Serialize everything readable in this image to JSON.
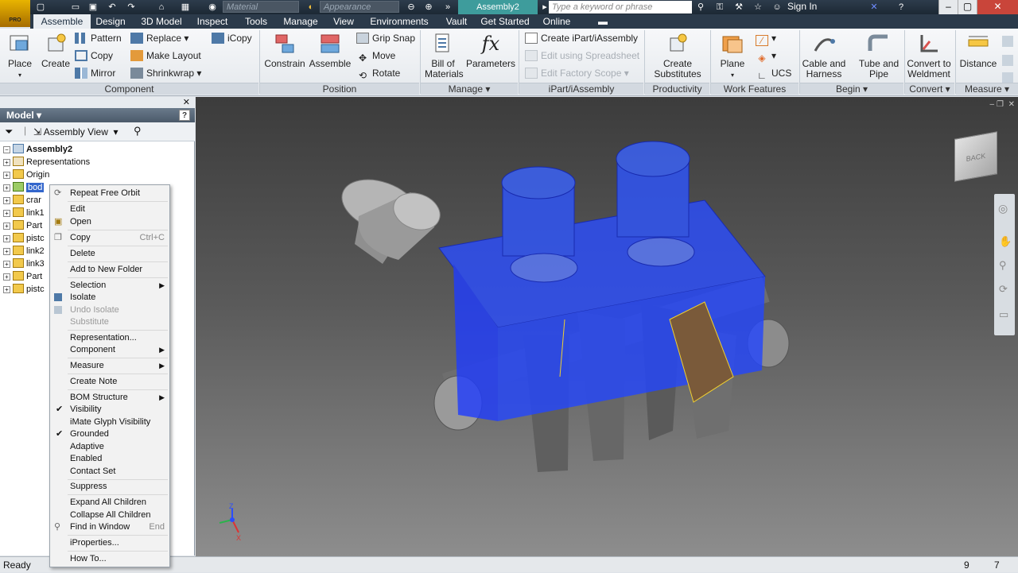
{
  "app": {
    "logo_text": "PRO"
  },
  "quickaccess": {
    "material_placeholder": "Material",
    "appearance_placeholder": "Appearance"
  },
  "title": {
    "document": "Assembly2",
    "search_placeholder": "Type a keyword or phrase",
    "sign_in": "Sign In"
  },
  "menu": [
    "Assemble",
    "Design",
    "3D Model",
    "Inspect",
    "Tools",
    "Manage",
    "View",
    "Environments",
    "Vault",
    "Get Started",
    "Online"
  ],
  "ribbon": {
    "groups": [
      "Component",
      "Position",
      "Manage",
      "iPart/iAssembly",
      "Productivity",
      "Work Features",
      "Begin",
      "Convert",
      "Measure"
    ],
    "component": {
      "place": "Place",
      "create": "Create",
      "pattern": "Pattern",
      "copy": "Copy",
      "mirror": "Mirror",
      "replace": "Replace",
      "make_layout": "Make Layout",
      "shrinkwrap": "Shrinkwrap",
      "icopy": "iCopy"
    },
    "position": {
      "constrain": "Constrain",
      "assemble": "Assemble",
      "grip_snap": "Grip Snap",
      "move": "Move",
      "rotate": "Rotate"
    },
    "manage": {
      "bom_line1": "Bill of",
      "bom_line2": "Materials",
      "parameters": "Parameters"
    },
    "ipart": {
      "create": "Create iPart/iAssembly",
      "edit_spreadsheet": "Edit using Spreadsheet",
      "edit_factory": "Edit Factory Scope"
    },
    "productivity": {
      "line1": "Create",
      "line2": "Substitutes"
    },
    "work_features": {
      "plane": "Plane",
      "ucs": "UCS"
    },
    "begin": {
      "cable_line1": "Cable and",
      "cable_line2": "Harness",
      "tube_line1": "Tube and",
      "tube_line2": "Pipe"
    },
    "convert": {
      "line1": "Convert to",
      "line2": "Weldment"
    },
    "measure": {
      "distance": "Distance"
    }
  },
  "panel": {
    "title": "Model",
    "view": "Assembly View"
  },
  "tree": [
    {
      "label": "Assembly2",
      "bold": true
    },
    {
      "label": "Representations"
    },
    {
      "label": "Origin"
    },
    {
      "label": "bod",
      "selected": true
    },
    {
      "label": "crar"
    },
    {
      "label": "link1"
    },
    {
      "label": "Part"
    },
    {
      "label": "pistc"
    },
    {
      "label": "link2"
    },
    {
      "label": "link3"
    },
    {
      "label": "Part"
    },
    {
      "label": "pistc"
    }
  ],
  "context_menu": {
    "repeat_free_orbit": "Repeat Free Orbit",
    "edit": "Edit",
    "open": "Open",
    "copy": "Copy",
    "copy_shortcut": "Ctrl+C",
    "delete": "Delete",
    "add_to_new_folder": "Add to New Folder",
    "selection": "Selection",
    "isolate": "Isolate",
    "undo_isolate": "Undo Isolate",
    "substitute": "Substitute",
    "representation": "Representation...",
    "component": "Component",
    "measure": "Measure",
    "create_note": "Create Note",
    "bom_structure": "BOM Structure",
    "visibility": "Visibility",
    "imate_glyph_visibility": "iMate Glyph Visibility",
    "grounded": "Grounded",
    "adaptive": "Adaptive",
    "enabled": "Enabled",
    "contact_set": "Contact Set",
    "suppress": "Suppress",
    "expand_all": "Expand All Children",
    "collapse_all": "Collapse All Children",
    "find_in_window": "Find in Window",
    "find_shortcut": "End",
    "properties": "iProperties...",
    "how_to": "How To..."
  },
  "viewcube": {
    "face": "BACK"
  },
  "triad": {
    "x": "X",
    "z": "Z"
  },
  "status": {
    "text": "Ready",
    "count1": "9",
    "count2": "7"
  },
  "colors": {
    "accent": "#3e9c9c",
    "selection_blue": "#1f3cff",
    "ribbon_dark": "#2b3a4a"
  }
}
